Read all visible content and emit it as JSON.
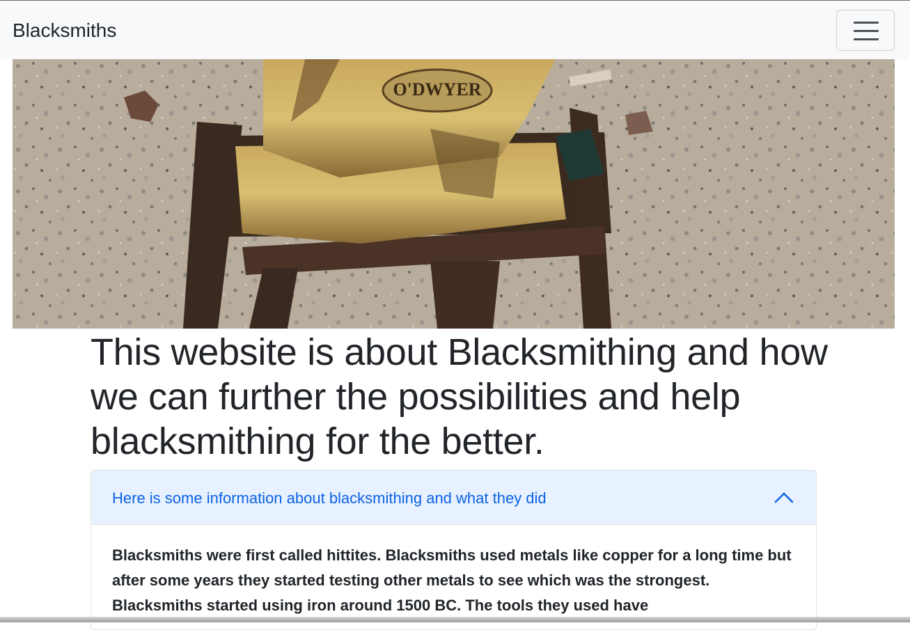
{
  "navbar": {
    "brand": "Blacksmiths",
    "toggler_icon": "hamburger-menu-icon"
  },
  "hero": {
    "image_description": "rusty anvil on metal stand",
    "anvil_stamp": "O'DWYER",
    "prev_icon": "chevron-left-icon",
    "next_icon": "chevron-right-icon"
  },
  "main": {
    "headline": "This website is about Blacksmithing and how we can further the possibilities and help blacksmithing for the better."
  },
  "accordion": {
    "header": "Here is some information about blacksmithing and what they did",
    "expanded": true,
    "chevron_icon": "chevron-up-icon",
    "body": "Blacksmiths were first called hittites. Blacksmiths used metals like copper for a long time but after some years they started testing other metals to see which was the strongest. Blacksmiths started using iron around 1500 BC. The tools they used have"
  },
  "colors": {
    "navbar_bg": "#f8f9fa",
    "accordion_header_bg": "#e7f1ff",
    "accordion_header_text": "#0c63e4",
    "text": "#212529"
  }
}
